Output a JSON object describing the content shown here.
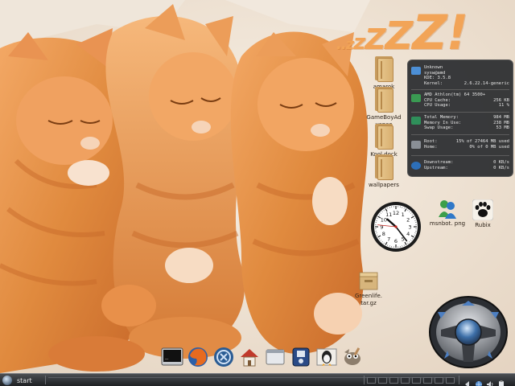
{
  "wallpaper": {
    "zzz_parts": [
      "..",
      "z",
      "z",
      "Z",
      "Z",
      "Z",
      "!"
    ]
  },
  "desktop_icons": [
    {
      "label": "amarok",
      "icon": "folder-icon"
    },
    {
      "label": "GameBoyAd vance",
      "icon": "folder-icon"
    },
    {
      "label": "Kool dock",
      "icon": "folder-icon"
    },
    {
      "label": "wallpapers",
      "icon": "folder-icon"
    }
  ],
  "extra_icons": {
    "msnbot": {
      "label": "msnbot. png",
      "icon": "msn-buddies-icon"
    },
    "rubix": {
      "label": "Rubix",
      "icon": "paw-icon"
    },
    "greenlife": {
      "label": "Greenlife. tar.gz",
      "icon": "archive-icon"
    }
  },
  "sysmon": {
    "system": [
      {
        "k": "Unknown",
        "v": ""
      },
      {
        "k": "sysw@amd",
        "v": ""
      },
      {
        "k": "KDE: 3.5.8",
        "v": ""
      },
      {
        "k": "Kernel:",
        "v": "2.6.22.14-generic"
      }
    ],
    "cpu": [
      {
        "k": "AMD Athlon(tm) 64 3500+",
        "v": ""
      },
      {
        "k": "CPU Cache:",
        "v": "256 KB"
      },
      {
        "k": "CPU Usage:",
        "v": "11 %"
      }
    ],
    "memory": [
      {
        "k": "Total Memory:",
        "v": "984 MB"
      },
      {
        "k": "Memory In Use:",
        "v": "238 MB"
      },
      {
        "k": "Swap Usage:",
        "v": "53 MB"
      }
    ],
    "disk": [
      {
        "k": "Root:",
        "v": "15% of 27464 MB used"
      },
      {
        "k": "Home:",
        "v": "0% of 0 MB used"
      }
    ],
    "network": [
      {
        "k": "Downstream:",
        "v": "0 KB/s"
      },
      {
        "k": "Upstream:",
        "v": "0 KB/s"
      }
    ]
  },
  "clock": {
    "hour": 10,
    "minute": 23,
    "second": 46
  },
  "dock": {
    "items": [
      "terminal-icon",
      "firefox-icon",
      "kde-icon",
      "home-icon",
      "window-icon",
      "disk-icon",
      "tux-icon",
      "gimp-icon"
    ]
  },
  "taskbar": {
    "start_label": "start",
    "tray_icons": [
      "arrow-left-icon",
      "network-icon",
      "volume-icon",
      "klipper-icon"
    ]
  },
  "colors": {
    "taskbar_top": "#4a4d52",
    "taskbar_bottom": "#1e2023",
    "zzz": "#f2a457",
    "sysmon_bg": "#282a2e"
  }
}
